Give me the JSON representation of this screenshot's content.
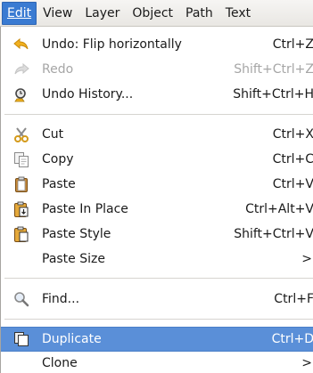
{
  "menubar": {
    "items": [
      "Edit",
      "View",
      "Layer",
      "Object",
      "Path",
      "Text"
    ]
  },
  "menu": {
    "items": [
      {
        "label": "Undo: Flip horizontally",
        "accel": "Ctrl+Z",
        "icon": "undo-icon"
      },
      {
        "label": "Redo",
        "accel": "Shift+Ctrl+Z",
        "icon": "redo-icon",
        "disabled": true
      },
      {
        "label": "Undo History...",
        "accel": "Shift+Ctrl+H",
        "icon": "undo-history-icon"
      },
      {
        "label": "Cut",
        "accel": "Ctrl+X",
        "icon": "cut-icon"
      },
      {
        "label": "Copy",
        "accel": "Ctrl+C",
        "icon": "copy-icon"
      },
      {
        "label": "Paste",
        "accel": "Ctrl+V",
        "icon": "paste-icon"
      },
      {
        "label": "Paste In Place",
        "accel": "Ctrl+Alt+V",
        "icon": "paste-in-place-icon"
      },
      {
        "label": "Paste Style",
        "accel": "Shift+Ctrl+V",
        "icon": "paste-style-icon"
      },
      {
        "label": "Paste Size",
        "accel": ">",
        "icon": ""
      },
      {
        "label": "Find...",
        "accel": "Ctrl+F",
        "icon": "find-icon"
      },
      {
        "label": "Duplicate",
        "accel": "Ctrl+D",
        "icon": "duplicate-icon",
        "selected": true
      },
      {
        "label": "Clone",
        "accel": ">",
        "icon": ""
      }
    ]
  },
  "colors": {
    "selection": "#5a8fd8",
    "menubar_active": "#3a7bd2",
    "disabled_text": "#a6a6a6"
  }
}
